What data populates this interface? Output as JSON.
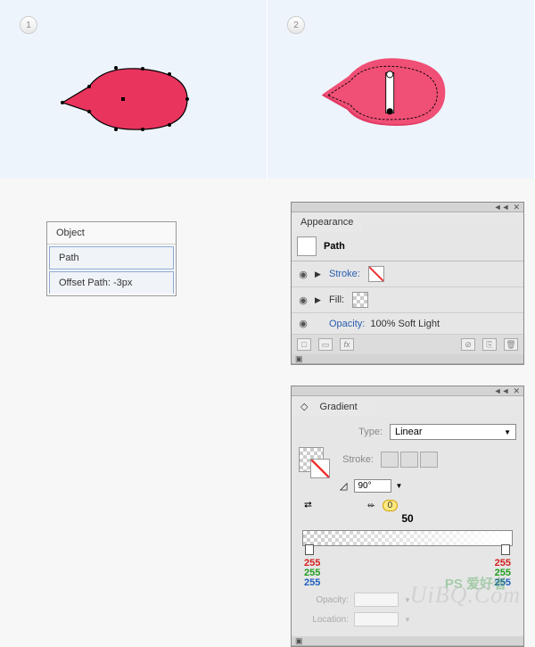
{
  "steps": {
    "one": "1",
    "two": "2"
  },
  "menu": {
    "object": "Object",
    "path": "Path",
    "offset": "Offset Path: -3px"
  },
  "appearance": {
    "title": "Appearance",
    "item": "Path",
    "stroke_label": "Stroke:",
    "fill_label": "Fill:",
    "opacity_label": "Opacity:",
    "opacity_value": "100% Soft Light",
    "fx": "fx"
  },
  "gradient": {
    "title": "Gradient",
    "type_label": "Type:",
    "type_value": "Linear",
    "stroke_label": "Stroke:",
    "angle": "90°",
    "mid": "0",
    "mid_below": "50",
    "opacity_label": "Opacity:",
    "location_label": "Location:",
    "rgb_left": {
      "r": "255",
      "g": "255",
      "b": "255"
    },
    "rgb_right": {
      "r": "255",
      "g": "255",
      "b": "255"
    }
  },
  "watermark": "UiBQ.Com"
}
